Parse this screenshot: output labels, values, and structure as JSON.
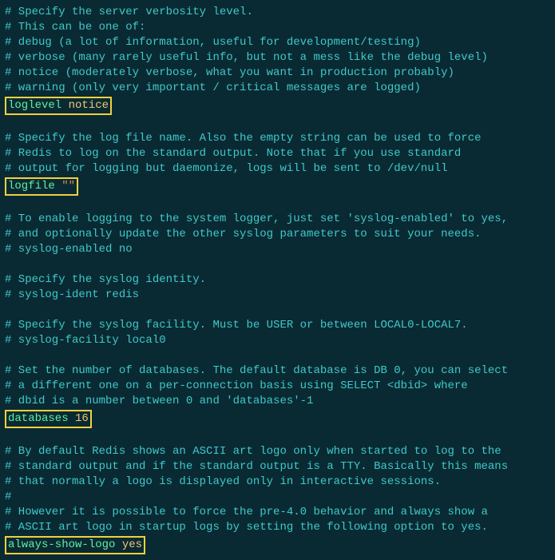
{
  "lines": [
    {
      "type": "comment",
      "text": "# Specify the server verbosity level."
    },
    {
      "type": "comment",
      "text": "# This can be one of:"
    },
    {
      "type": "comment",
      "text": "# debug (a lot of information, useful for development/testing)"
    },
    {
      "type": "comment",
      "text": "# verbose (many rarely useful info, but not a mess like the debug level)"
    },
    {
      "type": "comment",
      "text": "# notice (moderately verbose, what you want in production probably)"
    },
    {
      "type": "comment",
      "text": "# warning (only very important / critical messages are logged)"
    },
    {
      "type": "config",
      "key": "loglevel",
      "value": "notice",
      "value_type": "plain",
      "highlight": true
    },
    {
      "type": "empty"
    },
    {
      "type": "comment",
      "text": "# Specify the log file name. Also the empty string can be used to force"
    },
    {
      "type": "comment",
      "text": "# Redis to log on the standard output. Note that if you use standard"
    },
    {
      "type": "comment",
      "text": "# output for logging but daemonize, logs will be sent to /dev/null"
    },
    {
      "type": "config",
      "key": "logfile",
      "value": "\"\"",
      "value_type": "string",
      "highlight": true
    },
    {
      "type": "empty"
    },
    {
      "type": "comment",
      "text": "# To enable logging to the system logger, just set 'syslog-enabled' to yes,"
    },
    {
      "type": "comment",
      "text": "# and optionally update the other syslog parameters to suit your needs."
    },
    {
      "type": "comment",
      "text": "# syslog-enabled no"
    },
    {
      "type": "empty"
    },
    {
      "type": "comment",
      "text": "# Specify the syslog identity."
    },
    {
      "type": "comment",
      "text": "# syslog-ident redis"
    },
    {
      "type": "empty"
    },
    {
      "type": "comment",
      "text": "# Specify the syslog facility. Must be USER or between LOCAL0-LOCAL7."
    },
    {
      "type": "comment",
      "text": "# syslog-facility local0"
    },
    {
      "type": "empty"
    },
    {
      "type": "comment",
      "text": "# Set the number of databases. The default database is DB 0, you can select"
    },
    {
      "type": "comment",
      "text": "# a different one on a per-connection basis using SELECT <dbid> where"
    },
    {
      "type": "comment",
      "text": "# dbid is a number between 0 and 'databases'-1"
    },
    {
      "type": "config",
      "key": "databases",
      "value": "16",
      "value_type": "plain",
      "highlight": true
    },
    {
      "type": "empty"
    },
    {
      "type": "comment",
      "text": "# By default Redis shows an ASCII art logo only when started to log to the"
    },
    {
      "type": "comment",
      "text": "# standard output and if the standard output is a TTY. Basically this means"
    },
    {
      "type": "comment",
      "text": "# that normally a logo is displayed only in interactive sessions."
    },
    {
      "type": "comment",
      "text": "#"
    },
    {
      "type": "comment",
      "text": "# However it is possible to force the pre-4.0 behavior and always show a"
    },
    {
      "type": "comment",
      "text": "# ASCII art logo in startup logs by setting the following option to yes."
    },
    {
      "type": "config",
      "key": "always-show-logo",
      "value": "yes",
      "value_type": "plain",
      "highlight": true
    }
  ]
}
